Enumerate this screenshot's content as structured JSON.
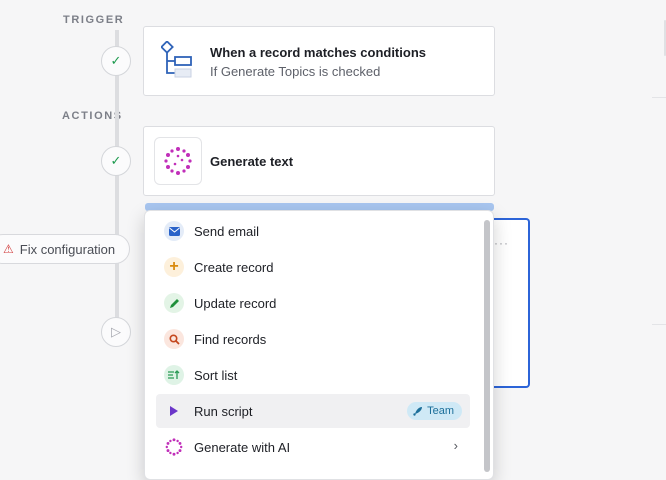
{
  "trigger_section": {
    "label": "TRIGGER"
  },
  "actions_section": {
    "label": "ACTIONS"
  },
  "trigger_card": {
    "title": "When a record matches conditions",
    "subtitle": "If Generate Topics is checked",
    "icon": "conditions-icon"
  },
  "action_card": {
    "title": "Generate text",
    "icon": "ai-dots-icon"
  },
  "fix_config": {
    "label": "Fix configuration",
    "icon": "warning-icon"
  },
  "menu": {
    "items": [
      {
        "label": "Send email",
        "icon": "envelope-icon",
        "color": "#2a63c9",
        "bg": "#e4ecf8"
      },
      {
        "label": "Create record",
        "icon": "plus-icon",
        "color": "#d98a0e",
        "bg": "#fdf0db"
      },
      {
        "label": "Update record",
        "icon": "pencil-icon",
        "color": "#1f8f3a",
        "bg": "#e3f4e6"
      },
      {
        "label": "Find records",
        "icon": "search-icon",
        "color": "#c4471e",
        "bg": "#fbe6de"
      },
      {
        "label": "Sort list",
        "icon": "sort-icon",
        "color": "#2a9a55",
        "bg": "#dff3e6"
      },
      {
        "label": "Run script",
        "icon": "play-icon",
        "color": "#6b36c9",
        "bg": "#ece5f8",
        "badge": "Team"
      },
      {
        "label": "Generate with AI",
        "icon": "ai-dots-icon",
        "color": "#c12fb9",
        "bg": "#ffffff"
      }
    ]
  }
}
